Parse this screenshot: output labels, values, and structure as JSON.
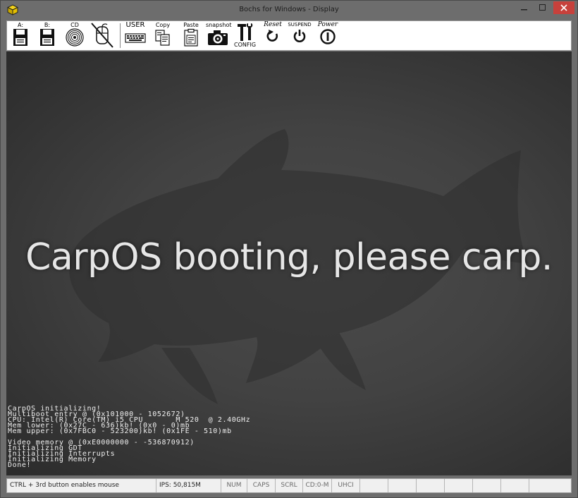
{
  "window": {
    "title": "Bochs for Windows - Display"
  },
  "toolbar": {
    "floppy_a": "A:",
    "floppy_b": "B:",
    "cdrom": "CD",
    "user": "USER",
    "copy": "Copy",
    "paste": "Paste",
    "snapshot": "snapshot",
    "config": "CONFIG",
    "reset": "Reset",
    "suspend": "SUSPEND",
    "power": "Power"
  },
  "screen": {
    "banner": "CarpOS booting, please carp.",
    "console": [
      "CarpOS initializing!",
      "Multiboot entry @ (0x101000 - 1052672)",
      "CPU: Intel(R) Core(TM) i5 CPU       M 520  @ 2.40GHz",
      "Mem lower: (0x27C - 636)kb! (0x0 - 0)mb",
      "Mem upper: (0x7FBC0 - 523200)kb! (0x1FE - 510)mb",
      "",
      "Video memory @ (0xE0000000 - -536870912)",
      "Initializing GDT",
      "Initializing Interrupts",
      "Initializing Memory",
      "Done!"
    ]
  },
  "statusbar": {
    "mouse_hint": "CTRL + 3rd button enables mouse",
    "ips": "IPS: 50,815M",
    "num": "NUM",
    "caps": "CAPS",
    "scrl": "SCRL",
    "cd": "CD:0-M",
    "uhci": "UHCI"
  },
  "colors": {
    "chrome": "#6d6d6d",
    "close_button": "#c7413c",
    "screen_bg": "#424242",
    "banner_text": "#e6e6e6"
  }
}
